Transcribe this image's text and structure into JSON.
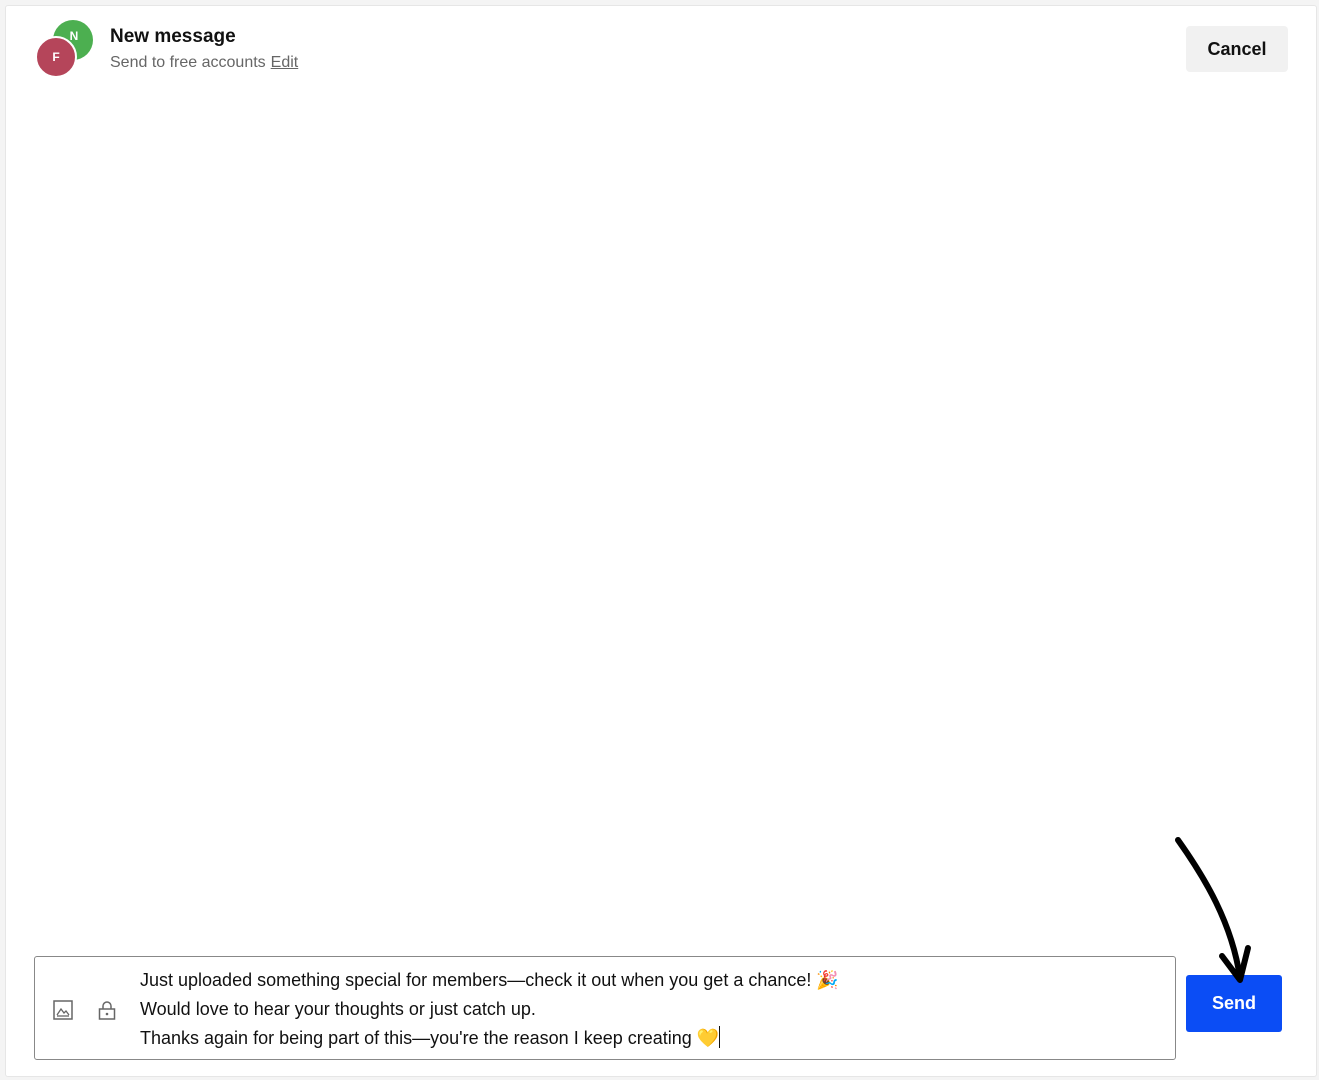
{
  "header": {
    "avatars": [
      {
        "initial": "N",
        "color": "#4caf50"
      },
      {
        "initial": "F",
        "color": "#b5455a"
      }
    ],
    "title": "New message",
    "subtitle": "Send to free accounts",
    "edit_label": "Edit",
    "cancel_label": "Cancel"
  },
  "composer": {
    "lines": [
      "Just uploaded something special for members—check it out when you get a chance! 🎉",
      "Would love to hear your thoughts or just catch up.",
      "Thanks again for being part of this—you're the reason I keep creating 💛"
    ],
    "icons": [
      "image-icon",
      "lock-icon"
    ]
  },
  "send_label": "Send",
  "colors": {
    "accent": "#0b4df5",
    "cancel_bg": "#f1f1f1"
  }
}
